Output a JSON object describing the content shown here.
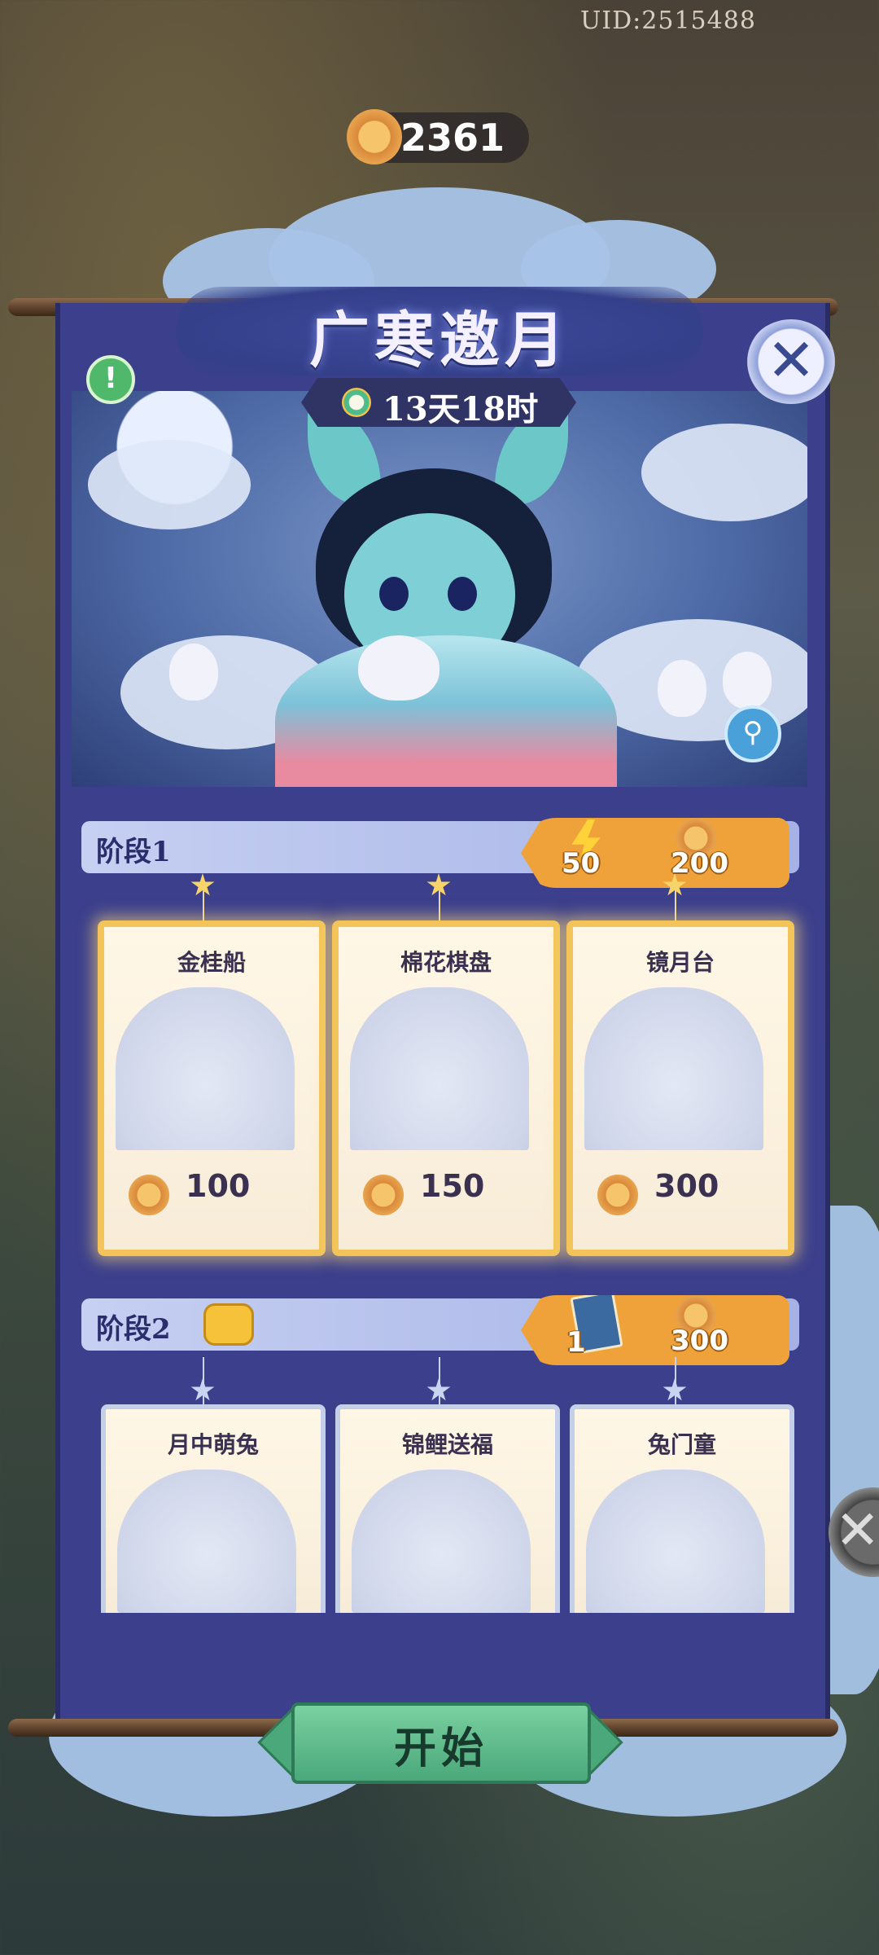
{
  "header": {
    "uid": "UID:2515488",
    "currency_amount": "2361"
  },
  "event": {
    "title": "广寒邀月",
    "timer": "13天18时"
  },
  "stages": [
    {
      "label": "阶段1",
      "rewards": {
        "energy": "50",
        "mooncake": "200"
      },
      "items": [
        {
          "name": "金桂船",
          "price": "100"
        },
        {
          "name": "棉花棋盘",
          "price": "150"
        },
        {
          "name": "镜月台",
          "price": "300"
        }
      ]
    },
    {
      "label": "阶段2",
      "rewards": {
        "cards": "1",
        "mooncake": "300"
      },
      "items": [
        {
          "name": "月中萌兔"
        },
        {
          "name": "锦鲤送福"
        },
        {
          "name": "兔门童"
        }
      ]
    }
  ],
  "actions": {
    "start": "开始"
  },
  "icons": {
    "close": "close-icon",
    "info": "info-icon",
    "zoom": "magnifier-icon",
    "currency": "mooncake-icon",
    "energy": "lightning-icon"
  }
}
